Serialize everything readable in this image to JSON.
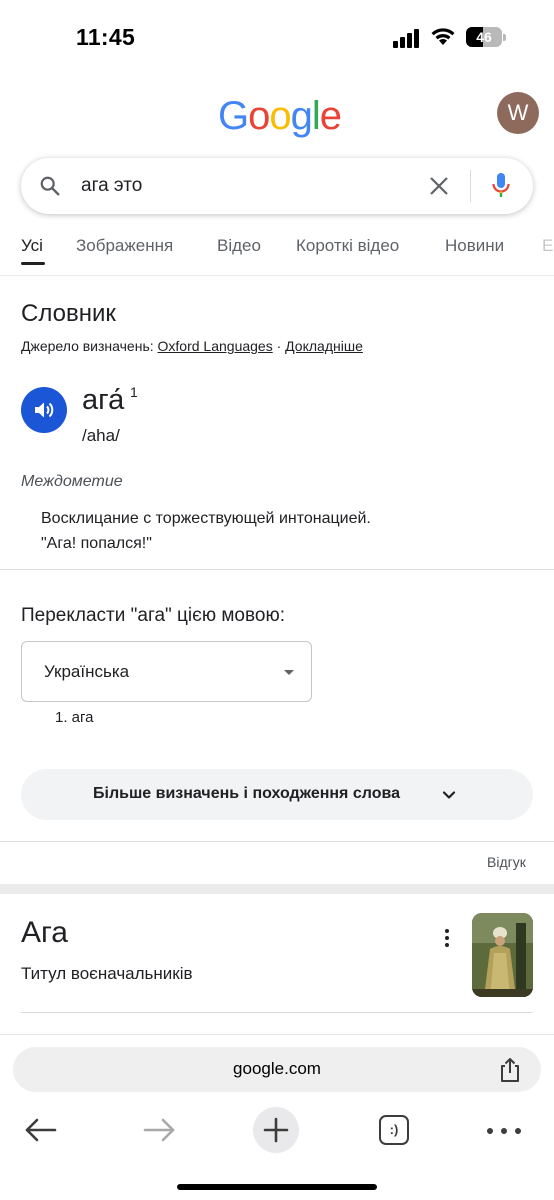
{
  "status_bar": {
    "time": "11:45",
    "battery": "46",
    "battery_level": 0.46
  },
  "header": {
    "logo_letters": [
      {
        "char": "G",
        "color": "#4285F4"
      },
      {
        "char": "o",
        "color": "#EA4335"
      },
      {
        "char": "o",
        "color": "#FBBC05"
      },
      {
        "char": "g",
        "color": "#4285F4"
      },
      {
        "char": "l",
        "color": "#34A853"
      },
      {
        "char": "e",
        "color": "#EA4335"
      }
    ],
    "avatar_letter": "W"
  },
  "search": {
    "query": "ага это"
  },
  "tabs": [
    "Усі",
    "Зображення",
    "Відео",
    "Короткі відео",
    "Новини",
    "Е"
  ],
  "dictionary": {
    "title": "Словник",
    "source_prefix": "Джерело визначень: ",
    "source_link": "Oxford Languages",
    "separator": " · ",
    "more_link": "Докладніше",
    "word": "ага́",
    "superscript": "1",
    "phonetic": "/aha/",
    "part_of_speech": "Междометие",
    "definition": "Восклицание с торжествующей интонацией.",
    "example": "\"Ага! попался!\""
  },
  "translate": {
    "title": "Перекласти \"ага\" цією мовою:",
    "language": "Українська",
    "result": "1. ага"
  },
  "more_button": {
    "label": "Більше визначень і походження слова"
  },
  "feedback": "Відгук",
  "knowledge_card": {
    "title": "Ага",
    "subtitle": "Титул воєначальників"
  },
  "browser": {
    "url": "google.com",
    "tabs_label": ":)"
  },
  "icons": [
    "signal-icon",
    "wifi-icon",
    "search-icon",
    "clear-icon",
    "mic-icon",
    "speaker-icon",
    "caret-icon",
    "chevron-down-icon",
    "kebab-icon",
    "share-icon",
    "back-icon",
    "forward-icon",
    "plus-icon",
    "tabs-icon",
    "more-icon"
  ]
}
